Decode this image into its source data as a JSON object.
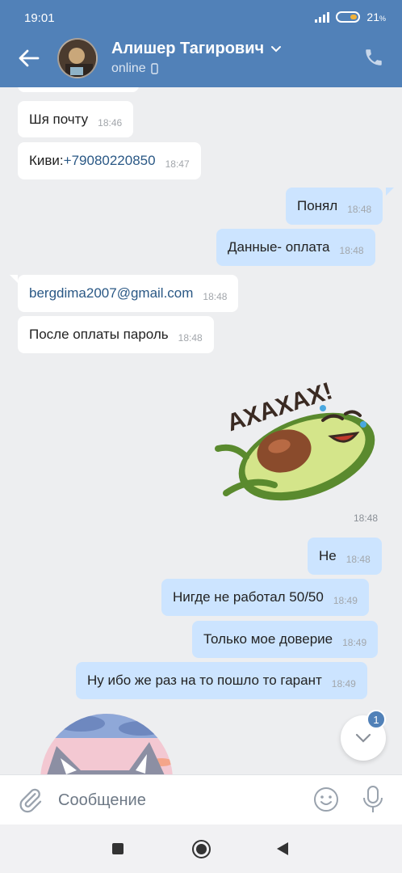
{
  "status": {
    "time": "19:01",
    "battery": "21",
    "battery_unit": "%"
  },
  "header": {
    "name": "Алишер Тагирович",
    "status": "online"
  },
  "messages": [
    {
      "dir": "in",
      "text": "Шя почту",
      "time": "18:46"
    },
    {
      "dir": "in",
      "text_prefix": "Киви:",
      "link": "+79080220850",
      "time": "18:47"
    },
    {
      "dir": "out",
      "text": "Понял",
      "time": "18:48"
    },
    {
      "dir": "out",
      "text": "Данные- оплата",
      "time": "18:48"
    },
    {
      "dir": "in",
      "link": "bergdima2007@gmail.com",
      "time": "18:48"
    },
    {
      "dir": "in",
      "text": "После оплаты пароль",
      "time": "18:48"
    },
    {
      "dir": "out",
      "text": "Не",
      "time": "18:48"
    },
    {
      "dir": "out",
      "text": "Нигде не работал 50/50",
      "time": "18:49"
    },
    {
      "dir": "out",
      "text": "Только мое доверие",
      "time": "18:49"
    },
    {
      "dir": "out",
      "text": "Ну ибо же раз на то пошло то гарант",
      "time": "18:49"
    }
  ],
  "sticker": {
    "caption": "АХАХАХ!",
    "time": "18:48"
  },
  "scroll": {
    "unread": "1"
  },
  "composer": {
    "placeholder": "Сообщение"
  },
  "colors": {
    "header": "#5181b8",
    "incoming": "#ffffff",
    "outgoing": "#cce4ff",
    "link": "#2a5885"
  }
}
